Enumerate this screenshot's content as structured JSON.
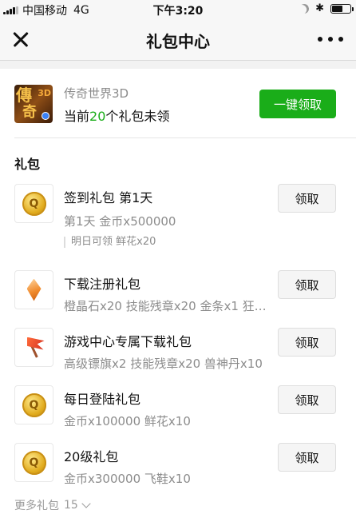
{
  "status_bar": {
    "carrier": "中国移动",
    "network": "4G",
    "time": "下午3:20",
    "battery_level": 0.6
  },
  "nav": {
    "title": "礼包中心"
  },
  "game": {
    "name": "传奇世界3D",
    "status_prefix": "当前",
    "unclaimed_count": "20",
    "status_suffix": "个礼包未领",
    "claim_all_label": "一键领取"
  },
  "section_title": "礼包",
  "claim_label": "领取",
  "gifts": [
    {
      "name": "签到礼包 第1天",
      "desc": "第1天 金币x500000",
      "note": "明日可领 鲜花x20",
      "icon": "gold-coin-icon"
    },
    {
      "name": "下载注册礼包",
      "desc": "橙晶石x20 技能残章x20 金条x1 狂暴之…",
      "icon": "orange-crystal-icon"
    },
    {
      "name": "游戏中心专属下载礼包",
      "desc": "高级镖旗x2 技能残章x20 兽神丹x10",
      "icon": "red-flag-icon"
    },
    {
      "name": "每日登陆礼包",
      "desc": "金币x100000 鲜花x10",
      "icon": "gold-coin-icon"
    },
    {
      "name": "20级礼包",
      "desc": "金币x300000 飞鞋x10",
      "icon": "gold-coin-icon"
    }
  ],
  "more": {
    "label": "更多礼包",
    "count": "15"
  }
}
